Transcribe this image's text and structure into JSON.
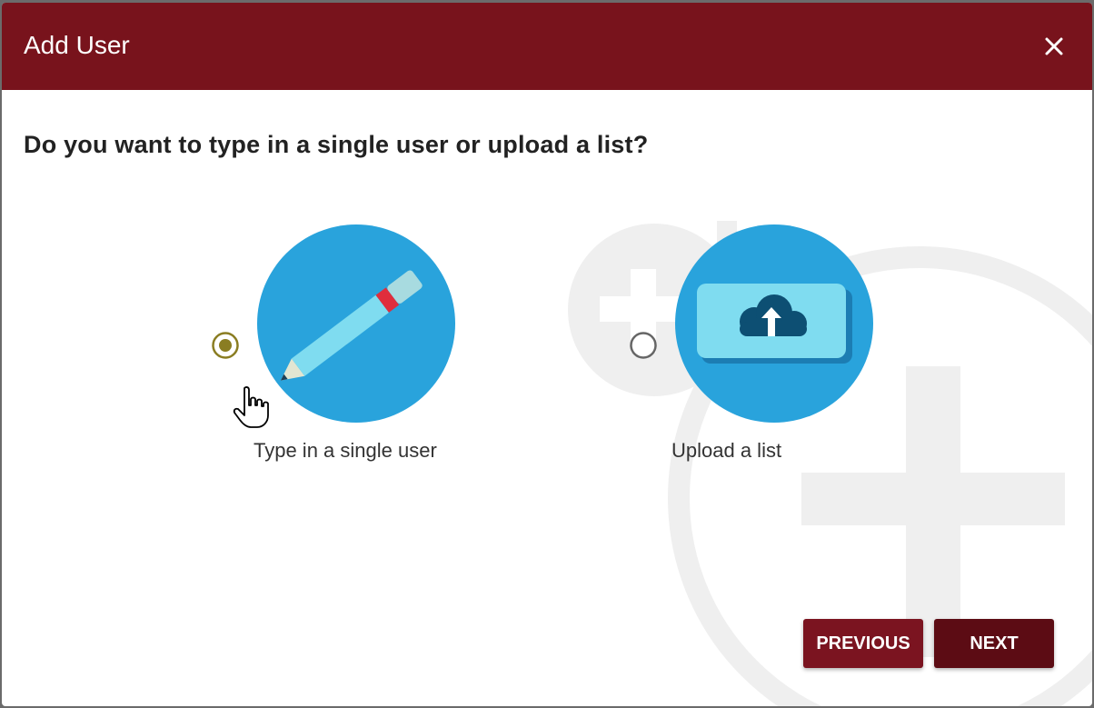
{
  "dialog": {
    "title": "Add User",
    "close_icon": "close-icon",
    "question": "Do you want to type in a single user or upload a list?"
  },
  "options": [
    {
      "label": "Type in a single user",
      "icon": "pencil-icon",
      "selected": true
    },
    {
      "label": "Upload a list",
      "icon": "cloud-upload-icon",
      "selected": false
    }
  ],
  "buttons": {
    "previous": "PREVIOUS",
    "next": "NEXT"
  },
  "colors": {
    "header": "#78131c",
    "button_previous": "#7b1420",
    "button_next": "#5c0c14",
    "icon_circle": "#29a3dc",
    "radio_selected": "#8a7d22"
  }
}
